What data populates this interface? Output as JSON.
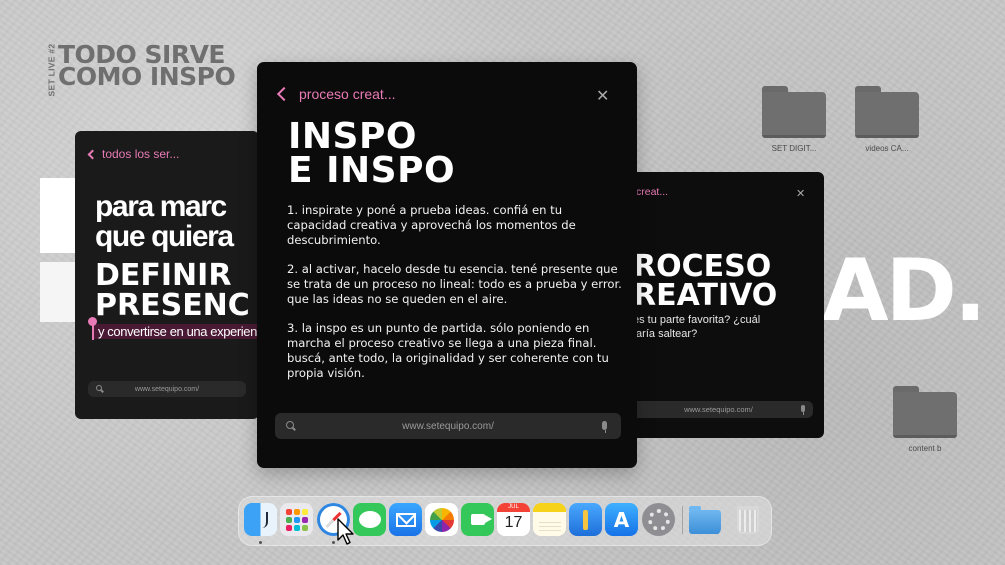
{
  "brand": {
    "tag": "SET LIVE #2",
    "line1": "TODO SIRVE",
    "line2": "COMO INSPO"
  },
  "background": {
    "right_text": "AD."
  },
  "desktop_folders": [
    {
      "label": "SET DIGIT..."
    },
    {
      "label": "videos CA..."
    },
    {
      "label": "content b"
    }
  ],
  "left_window": {
    "back_label": "todos los ser...",
    "text_line1": "para marc",
    "text_line2": "que quiera",
    "bold_line1": "DEFINIR",
    "bold_line2": "PRESENC",
    "sub": "y convertirse en una experien",
    "url": "www.setequipo.com/"
  },
  "main_window": {
    "back_label": "proceso creat...",
    "close": "✕",
    "title_line1": "INSPO",
    "title_line2": "E INSPO",
    "paragraphs": [
      "1. inspirate y poné a prueba ideas. confiá en tu capacidad creativa y aprovechá los momentos de descubrimiento.",
      "2. al activar, hacelo desde tu esencia. tené presente que se trata de un proceso no lineal: todo es a prueba y error. que las ideas no se queden en el aire.",
      "3. la inspo es un punto de partida. sólo poniendo en marcha el proceso creativo se llega a una pieza final. buscá, ante todo, la originalidad y ser coherente con tu propia visión."
    ],
    "url": "www.setequipo.com/"
  },
  "right_window": {
    "back_label": "creat...",
    "close": "✕",
    "title_line1": "ROCESO",
    "title_line2": "REATIVO",
    "text_line1": "es tu parte favorita? ¿cuál",
    "text_line2": "taría saltear?",
    "url": "www.setequipo.com/"
  },
  "dock": {
    "apps": [
      {
        "name": "finder"
      },
      {
        "name": "launchpad"
      },
      {
        "name": "safari"
      },
      {
        "name": "messages"
      },
      {
        "name": "mail"
      },
      {
        "name": "photos"
      },
      {
        "name": "facetime"
      },
      {
        "name": "calendar",
        "month": "JUL",
        "day": "17"
      },
      {
        "name": "notes"
      },
      {
        "name": "keynote"
      },
      {
        "name": "app-store",
        "glyph": "A"
      },
      {
        "name": "system-settings"
      },
      {
        "name": "downloads-folder"
      },
      {
        "name": "trash"
      }
    ]
  },
  "colors": {
    "accent_pink": "#e87bb6",
    "window_bg": "#0b0b0b",
    "desktop_bg": "#c6c6c6"
  }
}
